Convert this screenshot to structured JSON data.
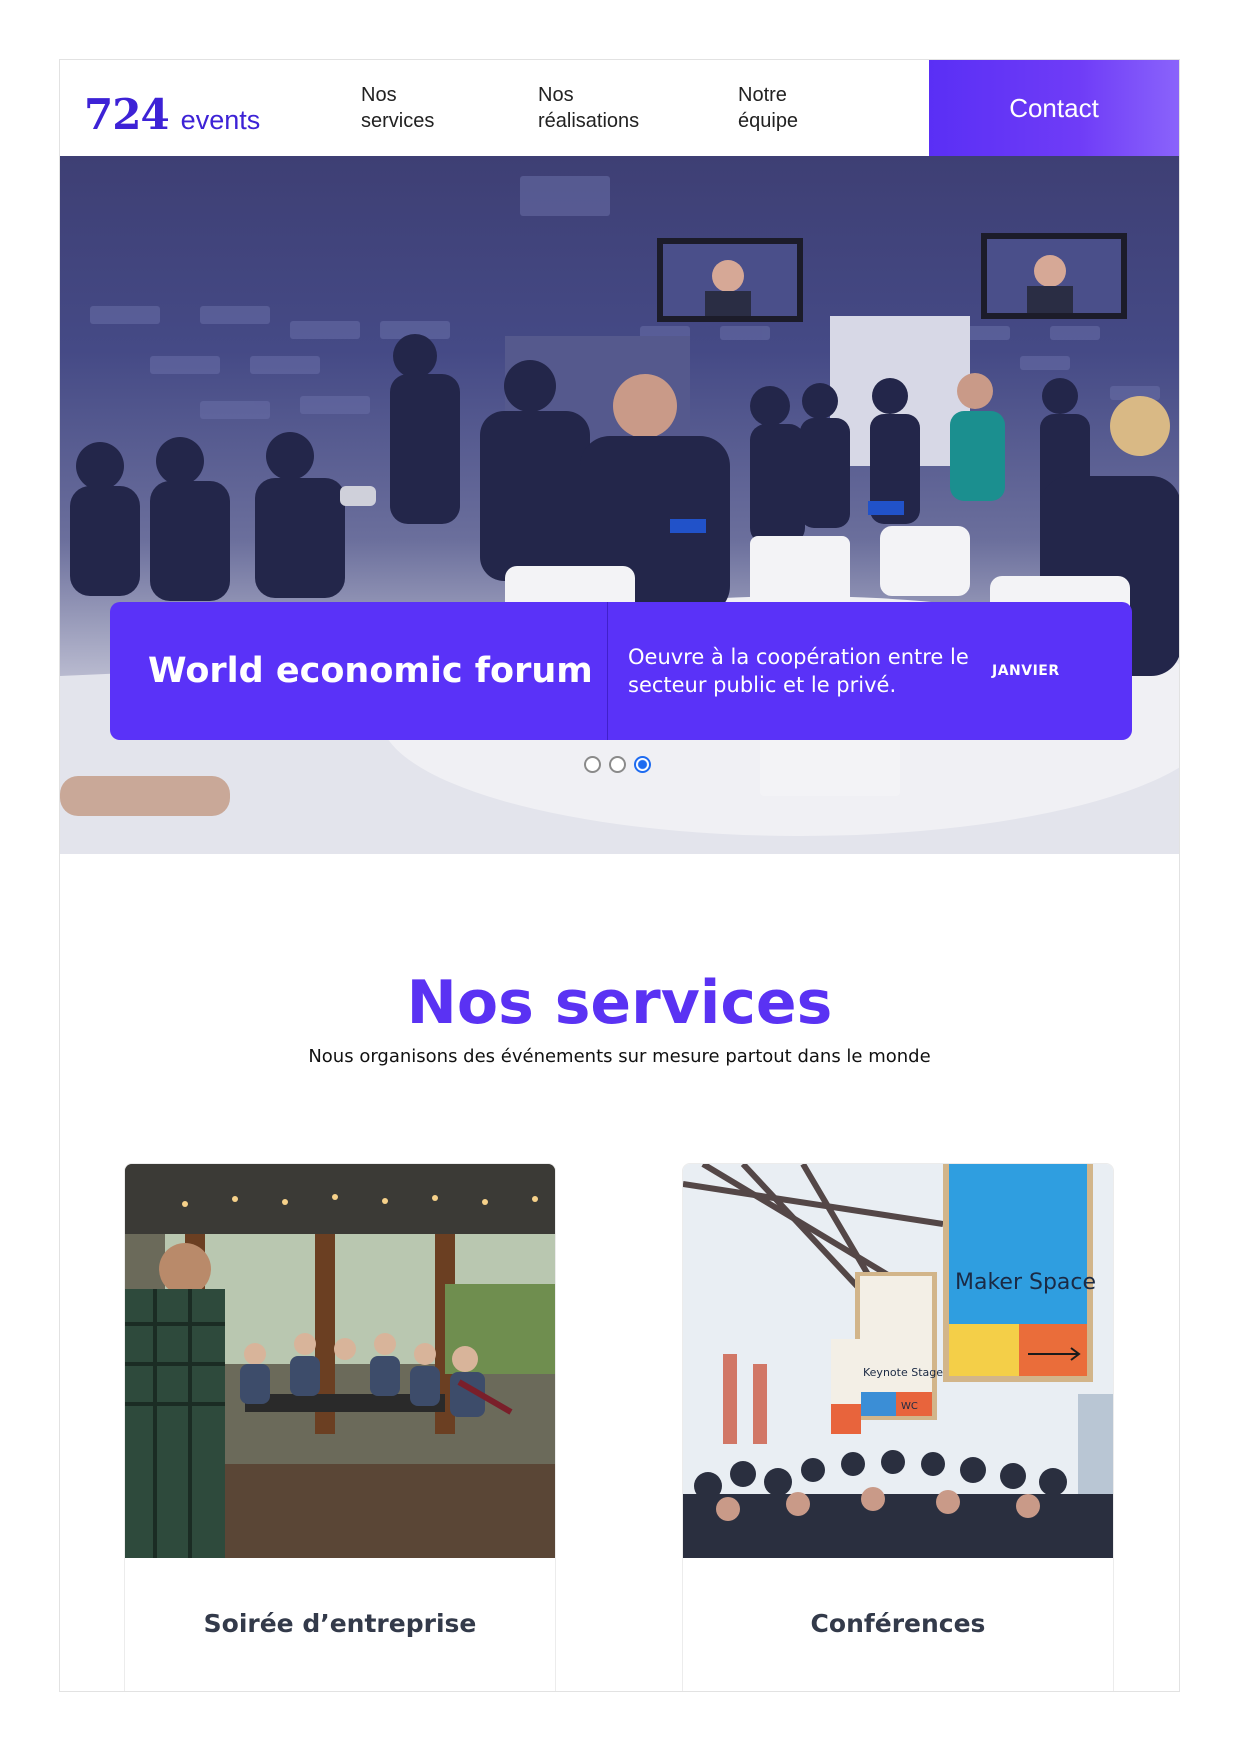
{
  "header": {
    "logo": {
      "number": "724",
      "word": "events"
    },
    "nav": [
      {
        "line1": "Nos",
        "line2": "services"
      },
      {
        "line1": "Nos",
        "line2": "réalisations"
      },
      {
        "line1": "Notre",
        "line2": "équipe"
      }
    ],
    "contact_label": "Contact"
  },
  "hero": {
    "image": "world-economic-forum-panel-photo",
    "caption": {
      "title": "World economic forum",
      "description": "Oeuvre à la coopération entre le secteur public et le privé.",
      "month": "JANVIER"
    },
    "slides_total": 3,
    "active_slide": 3
  },
  "services": {
    "title": "Nos services",
    "subtitle": "Nous organisons des événements sur mesure partout dans le monde",
    "cards": [
      {
        "title": "Soirée d’entreprise",
        "image": "corporate-evening-restaurant-photo"
      },
      {
        "title": "Conférences",
        "image": "conference-maker-space-photo"
      }
    ],
    "signage": {
      "maker": "Maker Space",
      "keynote": "Keynote Stage",
      "wc": "WC"
    }
  },
  "colors": {
    "accent": "#5a32f8",
    "logo": "#3d22d6",
    "title": "#5a32f3"
  }
}
